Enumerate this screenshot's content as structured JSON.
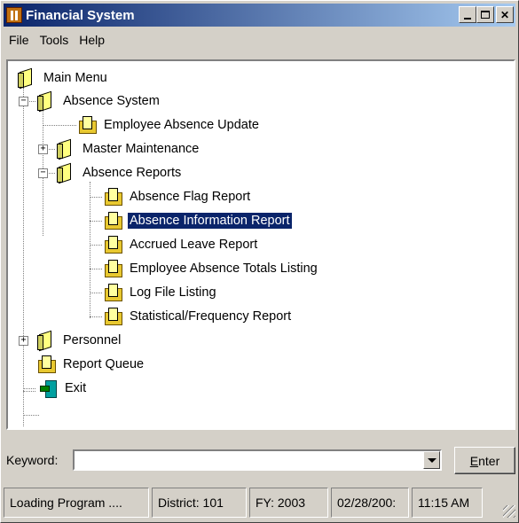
{
  "window": {
    "title": "Financial System"
  },
  "menubar": {
    "items": [
      "File",
      "Tools",
      "Help"
    ]
  },
  "tree": {
    "main_menu": "Main Menu",
    "absence_system": "Absence System",
    "employee_absence_update": "Employee Absence Update",
    "master_maintenance": "Master Maintenance",
    "absence_reports": "Absence Reports",
    "reports": [
      "Absence Flag Report",
      "Absence Information Report",
      "Accrued Leave Report",
      "Employee Absence Totals Listing",
      "Log File Listing",
      "Statistical/Frequency Report"
    ],
    "selected_report": "Absence Information Report",
    "personnel": "Personnel",
    "report_queue": "Report Queue",
    "exit": "Exit",
    "expanded_glyph": "−",
    "collapsed_glyph": "+"
  },
  "keyword": {
    "label": "Keyword:",
    "value": "",
    "placeholder": ""
  },
  "enter_button": {
    "accel": "E",
    "rest": "nter"
  },
  "statusbar": {
    "status": "Loading Program ....",
    "district": "District: 101",
    "fy": "FY: 2003",
    "date": "02/28/200:",
    "time": "11:15 AM"
  },
  "colors": {
    "titlebar_start": "#0a246a",
    "titlebar_end": "#a6caf0",
    "selection": "#0a246a",
    "face": "#d4d0c8"
  },
  "icons": {
    "app": "financial-system-app-icon",
    "menu_folder": "book-icon",
    "program": "report-folder-icon",
    "exit": "exit-door-icon"
  }
}
